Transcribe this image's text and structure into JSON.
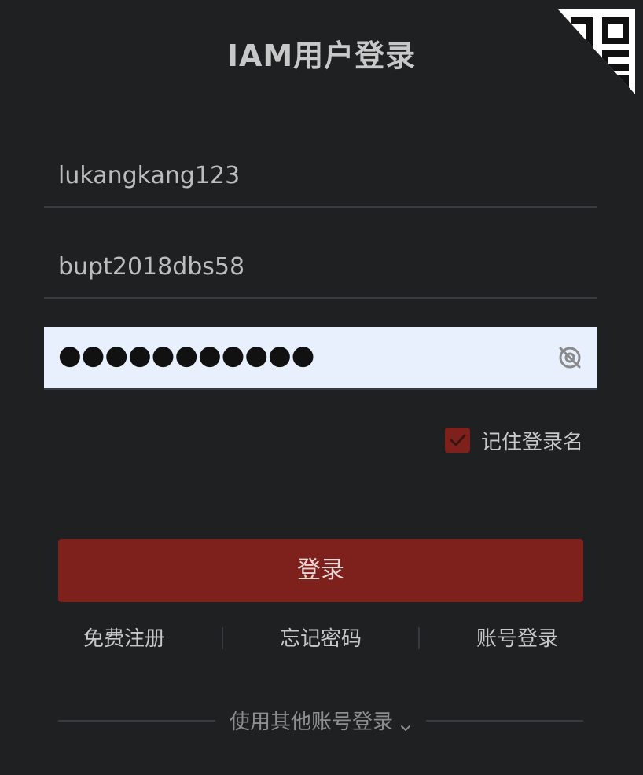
{
  "title": "IAM用户登录",
  "form": {
    "username_value": "lukangkang123",
    "account_value": "bupt2018dbs58",
    "password_value": "●●●●●●●●●●●",
    "remember_label": "记住登录名",
    "remember_checked": true,
    "login_button_label": "登录"
  },
  "links": {
    "register": "免费注册",
    "forgot": "忘记密码",
    "account_login": "账号登录"
  },
  "other_login_label": "使用其他账号登录",
  "colors": {
    "background": "#1f2022",
    "accent": "#7e211d",
    "password_bg": "#e8f0fe"
  },
  "icons": {
    "qr": "qr-code-corner-icon",
    "eye": "eye-off-icon",
    "check": "check-icon",
    "chevron": "chevron-down-icon"
  }
}
